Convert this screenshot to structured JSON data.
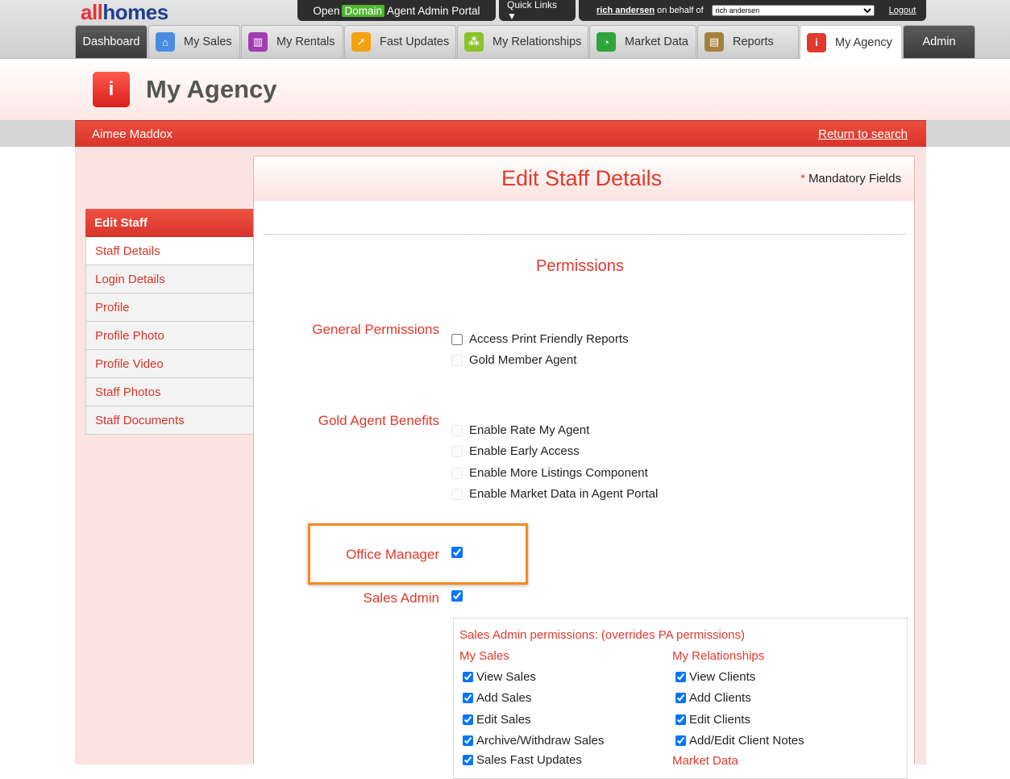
{
  "brand": {
    "logo_a": "all",
    "logo_b": "homes"
  },
  "topbar": {
    "portal_prefix": "Open",
    "portal_domain": "Domain",
    "portal_suffix": "Agent Admin Portal",
    "quick_links": "Quick Links ▼",
    "user_name": "rich andersen",
    "behalf_text": "on behalf of",
    "behalf_selected": "rich andersen",
    "logout": "Logout"
  },
  "tabs": [
    {
      "label": "Dashboard",
      "icon": ""
    },
    {
      "label": "My Sales",
      "icon": "house-icon",
      "color": "#4a8de0"
    },
    {
      "label": "My Rentals",
      "icon": "building-icon",
      "color": "#a23bb3"
    },
    {
      "label": "Fast Updates",
      "icon": "runner-icon",
      "color": "#f2a20f"
    },
    {
      "label": "My Relationships",
      "icon": "people-icon",
      "color": "#8cc22b"
    },
    {
      "label": "Market Data",
      "icon": "pie-chart-icon",
      "color": "#2ea53a"
    },
    {
      "label": "Reports",
      "icon": "folder-icon",
      "color": "#a5803d"
    },
    {
      "label": "My Agency",
      "icon": "info-person-icon",
      "color": "#e2392c"
    },
    {
      "label": "Admin",
      "icon": ""
    }
  ],
  "header": {
    "title": "My Agency"
  },
  "redbar": {
    "staff_name": "Aimee Maddox",
    "return_link": "Return to search"
  },
  "sidenav": {
    "heading": "Edit Staff",
    "items": [
      "Staff Details",
      "Login Details",
      "Profile",
      "Profile Photo",
      "Profile Video",
      "Staff Photos",
      "Staff Documents"
    ]
  },
  "panel": {
    "title": "Edit Staff Details",
    "mandatory_star": "*",
    "mandatory_text": "Mandatory Fields",
    "permissions_title": "Permissions"
  },
  "general": {
    "label": "General Permissions",
    "items": [
      {
        "text": "Access Print Friendly Reports",
        "checked": false,
        "disabled": false
      },
      {
        "text": "Gold Member Agent",
        "checked": false,
        "disabled": true
      }
    ]
  },
  "gold": {
    "label": "Gold Agent Benefits",
    "items": [
      {
        "text": "Enable Rate My Agent",
        "checked": false,
        "disabled": true
      },
      {
        "text": "Enable Early Access",
        "checked": false,
        "disabled": true
      },
      {
        "text": "Enable More Listings Component",
        "checked": false,
        "disabled": true
      },
      {
        "text": "Enable Market Data in Agent Portal",
        "checked": false,
        "disabled": true
      }
    ]
  },
  "office_manager": {
    "label": "Office Manager",
    "checked": true
  },
  "sales_admin": {
    "label": "Sales Admin",
    "checked": true
  },
  "sales_admin_box": {
    "title": "Sales Admin permissions: (overrides PA permissions)",
    "col1_heading": "My Sales",
    "col1": [
      "View Sales",
      "Add Sales",
      "Edit Sales",
      "Archive/Withdraw Sales",
      "Sales Fast Updates"
    ],
    "col2_heading": "My Relationships",
    "col2": [
      "View Clients",
      "Add Clients",
      "Edit Clients",
      "Add/Edit Client Notes"
    ],
    "col2_heading2": "Market Data"
  },
  "colors": {
    "accent": "#e1392c",
    "highlight": "#f58a1f",
    "domain_green": "#4fb42f"
  }
}
